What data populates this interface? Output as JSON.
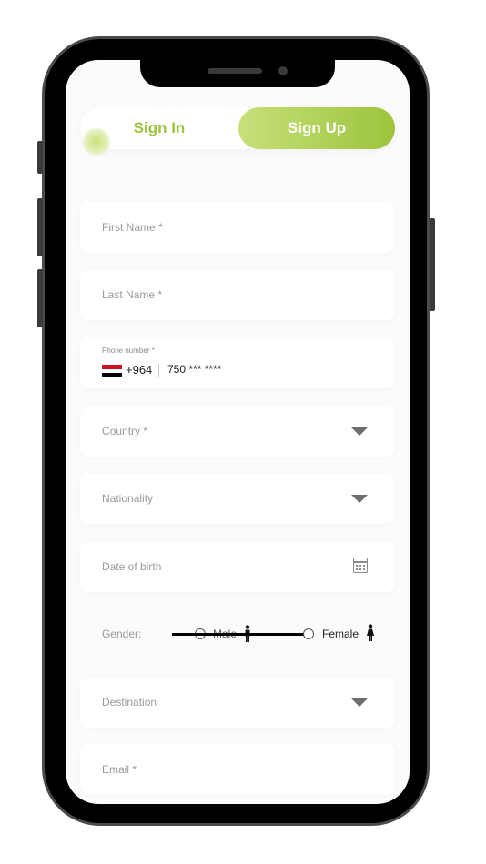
{
  "tabs": {
    "sign_in": "Sign In",
    "sign_up": "Sign Up"
  },
  "fields": {
    "first_name": "First Name *",
    "last_name": "Last Name *",
    "phone": {
      "label": "Phone number *",
      "code": "+964",
      "number": "750 *** ****"
    },
    "country": "Country *",
    "nationality": "Nationality",
    "date_of_birth": "Date of birth",
    "destination": "Destination",
    "email": "Email *"
  },
  "gender": {
    "label": "Gender:",
    "male": "Male",
    "female": "Female"
  },
  "colors": {
    "accent": "#9cc43c",
    "accent_light": "#c7e07a"
  }
}
